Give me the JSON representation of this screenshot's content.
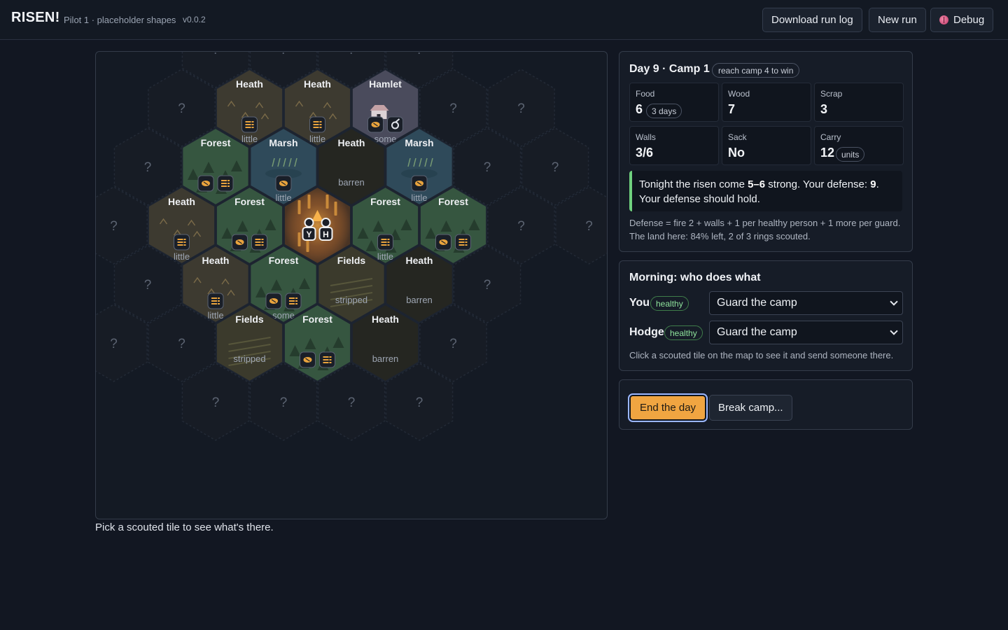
{
  "header": {
    "brand": "RISEN!",
    "subtitle": "Pilot 1 · placeholder shapes",
    "version": "v0.0.2",
    "download_label": "Download run log",
    "new_run_label": "New run",
    "debug_label": "Debug",
    "debug_icon": "bug-icon"
  },
  "map": {
    "hint": "Pick a scouted tile to see what's there.",
    "unknown_label": "?",
    "camp": {
      "people": [
        "Y",
        "H"
      ]
    },
    "tiles": [
      {
        "q": 0,
        "r": -4,
        "known": false
      },
      {
        "q": 1,
        "r": -4,
        "known": false
      },
      {
        "q": 2,
        "r": -4,
        "known": false
      },
      {
        "q": 3,
        "r": -4,
        "known": false
      },
      {
        "q": -1,
        "r": -3,
        "known": false
      },
      {
        "q": 0,
        "r": -3,
        "known": true,
        "terrain": "heath",
        "name": "Heath",
        "yield": "little",
        "icons": [
          "scrap"
        ]
      },
      {
        "q": 1,
        "r": -3,
        "known": true,
        "terrain": "heath",
        "name": "Heath",
        "yield": "little",
        "icons": [
          "scrap"
        ]
      },
      {
        "q": 2,
        "r": -3,
        "known": true,
        "terrain": "hamlet",
        "name": "Hamlet",
        "yield": "some",
        "icons": [
          "food",
          "tool"
        ]
      },
      {
        "q": 3,
        "r": -3,
        "known": false
      },
      {
        "q": -2,
        "r": -2,
        "known": false
      },
      {
        "q": -1,
        "r": -2,
        "known": true,
        "terrain": "forest",
        "name": "Forest",
        "yield": "",
        "icons": [
          "food",
          "scrap"
        ]
      },
      {
        "q": 0,
        "r": -2,
        "known": true,
        "terrain": "marsh",
        "name": "Marsh",
        "yield": "little",
        "icons": [
          "food"
        ]
      },
      {
        "q": 1,
        "r": -2,
        "known": true,
        "terrain": "barren",
        "name": "Heath",
        "yield": "barren",
        "icons": []
      },
      {
        "q": 2,
        "r": -2,
        "known": true,
        "terrain": "marsh",
        "name": "Marsh",
        "yield": "little",
        "icons": [
          "food"
        ]
      },
      {
        "q": 3,
        "r": -2,
        "known": false
      },
      {
        "q": -3,
        "r": -1,
        "known": false
      },
      {
        "q": -2,
        "r": -1,
        "known": true,
        "terrain": "heath",
        "name": "Heath",
        "yield": "little",
        "icons": [
          "scrap"
        ]
      },
      {
        "q": -1,
        "r": -1,
        "known": true,
        "terrain": "forest",
        "name": "Forest",
        "yield": "",
        "icons": [
          "food",
          "scrap"
        ]
      },
      {
        "q": 0,
        "r": -1,
        "known": true,
        "terrain": "camp",
        "name": "",
        "yield": "",
        "icons": []
      },
      {
        "q": 1,
        "r": -1,
        "known": true,
        "terrain": "forest",
        "name": "Forest",
        "yield": "little",
        "icons": [
          "scrap"
        ]
      },
      {
        "q": 2,
        "r": -1,
        "known": true,
        "terrain": "forest",
        "name": "Forest",
        "yield": "",
        "icons": [
          "food",
          "scrap"
        ]
      },
      {
        "q": 3,
        "r": -1,
        "known": false
      },
      {
        "q": -3,
        "r": 0,
        "known": false
      },
      {
        "q": -2,
        "r": 0,
        "known": true,
        "terrain": "heath",
        "name": "Heath",
        "yield": "little",
        "icons": [
          "scrap"
        ]
      },
      {
        "q": -1,
        "r": 0,
        "known": true,
        "terrain": "forest",
        "name": "Forest",
        "yield": "some",
        "icons": [
          "food",
          "scrap"
        ]
      },
      {
        "q": 0,
        "r": 0,
        "known": true,
        "terrain": "fields",
        "name": "Fields",
        "yield": "stripped",
        "icons": []
      },
      {
        "q": 1,
        "r": 0,
        "known": true,
        "terrain": "barren",
        "name": "Heath",
        "yield": "barren",
        "icons": []
      },
      {
        "q": 2,
        "r": 0,
        "known": false
      },
      {
        "q": -3,
        "r": 1,
        "known": false
      },
      {
        "q": -2,
        "r": 1,
        "known": true,
        "terrain": "fields",
        "name": "Fields",
        "yield": "stripped",
        "icons": []
      },
      {
        "q": -1,
        "r": 1,
        "known": true,
        "terrain": "forest",
        "name": "Forest",
        "yield": "",
        "icons": [
          "food",
          "scrap"
        ]
      },
      {
        "q": 0,
        "r": 1,
        "known": true,
        "terrain": "barren",
        "name": "Heath",
        "yield": "barren",
        "icons": []
      },
      {
        "q": 1,
        "r": 1,
        "known": false
      },
      {
        "q": -3,
        "r": 2,
        "known": false
      },
      {
        "q": -2,
        "r": 2,
        "known": false
      },
      {
        "q": -1,
        "r": 2,
        "known": false
      },
      {
        "q": 0,
        "r": 2,
        "known": false
      },
      {
        "q": -4,
        "r": 1,
        "known": false
      },
      {
        "q": 4,
        "r": -3,
        "known": false
      },
      {
        "q": 4,
        "r": -2,
        "known": false
      },
      {
        "q": 4,
        "r": -1,
        "known": false
      }
    ]
  },
  "status": {
    "day_title": "Day 9 · Camp 1",
    "win_chip": "reach camp 4 to win",
    "food_label": "Food",
    "food_value": "6",
    "food_chip": "3 days",
    "wood_label": "Wood",
    "wood_value": "7",
    "scrap_label": "Scrap",
    "scrap_value": "3",
    "walls_label": "Walls",
    "walls_value": "3/6",
    "sack_label": "Sack",
    "sack_value": "No",
    "carry_label": "Carry",
    "carry_value": "12",
    "carry_chip": "units",
    "forecast_pre": "Tonight the risen come ",
    "forecast_count": "5–6",
    "forecast_mid": " strong. Your defense: ",
    "forecast_defense": "9",
    "forecast_post": ".",
    "forecast_line2": "Your defense should hold.",
    "forecast_accent": "#6fd17e",
    "defense_note": "Defense = fire 2 + walls + 1 per healthy person + 1 more per guard.",
    "land_note": "The land here: 84% left, 2 of 3 rings scouted."
  },
  "morning": {
    "title": "Morning: who does what",
    "people": [
      {
        "name": "You",
        "health": "healthy",
        "task": "Guard the camp"
      },
      {
        "name": "Hodge",
        "health": "healthy",
        "task": "Guard the camp"
      }
    ],
    "hint": "Click a scouted tile on the map to see it and send someone there."
  },
  "actions": {
    "end_day": "End the day",
    "break_camp": "Break camp...",
    "accent": "#f0a541"
  },
  "colors": {
    "forest": "#365640",
    "marsh": "#2f4a5a",
    "heath": "#3d3a30",
    "hamlet": "#4a4b5c",
    "fields": "#3b3a2c",
    "barren": "#252621",
    "unknown": "#171c25"
  }
}
